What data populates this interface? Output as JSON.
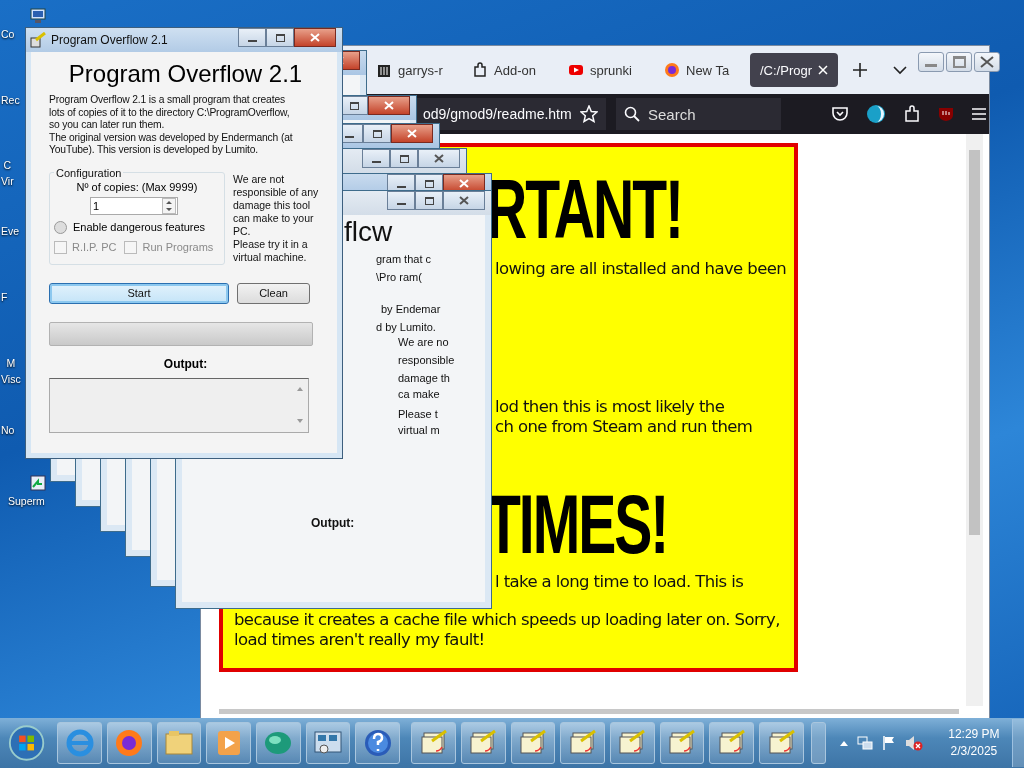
{
  "desktop_icons": [
    {
      "label": "Co",
      "kind": "computer"
    },
    {
      "label": "Rec",
      "kind": "none"
    },
    {
      "label": "C\nVir",
      "kind": "none"
    },
    {
      "label": "Eve",
      "kind": "none"
    },
    {
      "label": "F",
      "kind": "none"
    },
    {
      "label": "M\nVisc",
      "kind": "none"
    },
    {
      "label": "No",
      "kind": "none"
    },
    {
      "label": "Superm",
      "kind": "shortcut"
    }
  ],
  "browser": {
    "tabs": [
      {
        "label": "garrys-r",
        "kind": "trash",
        "selected": false
      },
      {
        "label": "Add-on",
        "kind": "addon",
        "selected": false
      },
      {
        "label": "sprunki",
        "kind": "youtube",
        "selected": false
      },
      {
        "label": "New Ta",
        "kind": "firefox",
        "selected": false
      },
      {
        "label": "/C:/Progr",
        "kind": "none",
        "selected": true
      }
    ],
    "address": "od9/gmod9/readme.htm",
    "search": {
      "placeholder": "Search"
    },
    "page": [
      {
        "kind": "heading",
        "text": "RTANT!"
      },
      {
        "kind": "text",
        "text": "lowing are all installed and have been"
      },
      {
        "kind": "text",
        "text": "lod then this is most likely the\nch one from Steam and run them"
      },
      {
        "kind": "heading",
        "text": "TIMES!"
      },
      {
        "kind": "text",
        "text": "l take a long time to load. This is"
      },
      {
        "kind": "wide",
        "text": "because it creates a cache file which speeds up loading later on. Sorry,\nload times aren't really my fault!"
      }
    ]
  },
  "ghost_windows": [
    {
      "active": true
    },
    {
      "active": true
    },
    {
      "active": true
    },
    {
      "active": false
    },
    {
      "active": true
    },
    {
      "active": false
    }
  ],
  "ghost_fragments": [
    "flcw",
    "gram that c",
    "\\Pro ram(",
    "by Endemar",
    "d by Lumito.",
    "We are no",
    "responsible",
    "damage th",
    "ca make",
    "Please t",
    "virtual m",
    "Output:"
  ],
  "dialog": {
    "title": "Program Overflow 2.1",
    "heading": "Program Overflow 2.1",
    "description": "Program Overflow 2.1 is a small program that creates\nlots of copies of it to the directory C:\\ProgramOverflow,\nso you can later run them.\nThe original version was developed by Endermanch (at\nYouTube). This version is developed by Lumito.",
    "group_title": "Configuration",
    "copies_label": "Nº of copies: (Max 9999)",
    "copies_value": "1",
    "dangerous": {
      "label": "Enable dangerous features",
      "selected": false
    },
    "options": [
      {
        "label": "R.I.P. PC",
        "checked": false,
        "disabled": true
      },
      {
        "label": "Run Programs",
        "checked": false,
        "disabled": true
      }
    ],
    "note": "We are not\nresponsible of any\ndamage this tool\ncan make to your\nPC.\nPlease try it in a\nvirtual machine.",
    "buttons": [
      {
        "label": "Start",
        "default": true
      },
      {
        "label": "Clean",
        "default": false
      }
    ],
    "progress": {
      "level": 0
    },
    "output_label": "Output:"
  },
  "taskbar": {
    "items": [
      {
        "kind": "ie"
      },
      {
        "kind": "firefox"
      },
      {
        "kind": "folder"
      },
      {
        "kind": "media"
      },
      {
        "kind": "orb"
      },
      {
        "kind": "panel"
      },
      {
        "kind": "help"
      },
      {
        "kind": "app"
      },
      {
        "kind": "app"
      },
      {
        "kind": "app"
      },
      {
        "kind": "app"
      },
      {
        "kind": "app"
      },
      {
        "kind": "app"
      },
      {
        "kind": "app"
      },
      {
        "kind": "app"
      }
    ],
    "time": "12:29 PM",
    "date": "2/3/2025"
  }
}
